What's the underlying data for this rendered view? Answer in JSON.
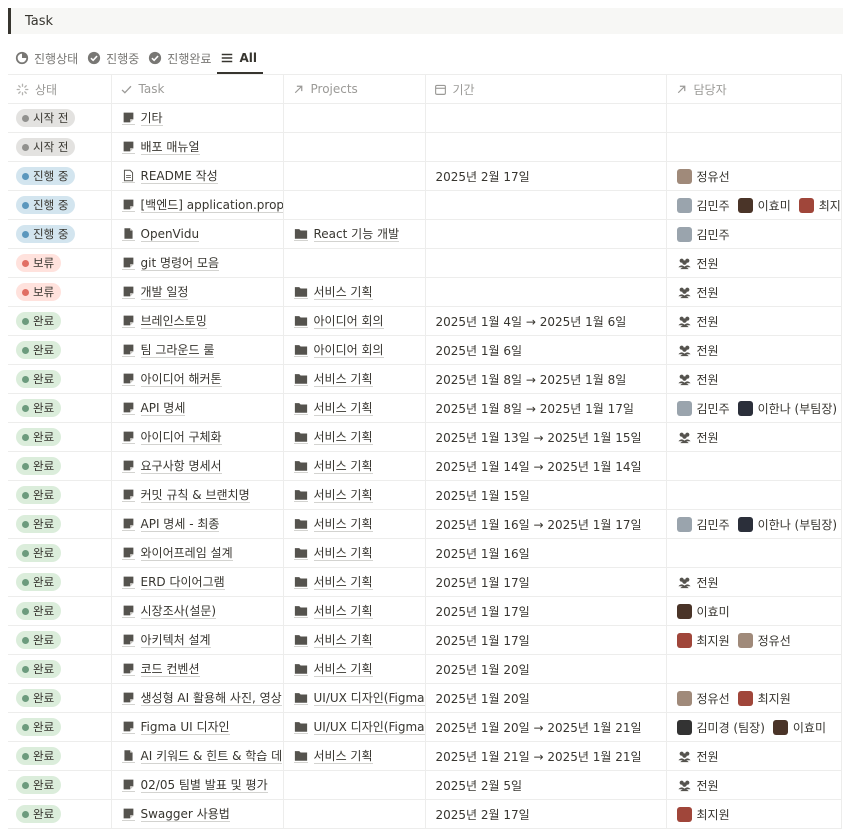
{
  "title": "Task",
  "tabs": [
    {
      "label": "진행상태",
      "icon": "progress-icon",
      "active": false
    },
    {
      "label": "진행중",
      "icon": "check-circle-icon",
      "active": false
    },
    {
      "label": "진행완료",
      "icon": "check-circle-icon",
      "active": false
    },
    {
      "label": "All",
      "icon": "list-icon",
      "active": true
    }
  ],
  "columns": {
    "status": "상태",
    "task": "Task",
    "projects": "Projects",
    "period": "기간",
    "assignee": "담당자"
  },
  "status_colors": {
    "시작 전": {
      "bg": "#e3e2e0",
      "dot": "#91918e"
    },
    "진행 중": {
      "bg": "#d3e5ef",
      "dot": "#5b97bd"
    },
    "보류": {
      "bg": "#ffe2dd",
      "dot": "#e16f64"
    },
    "완료": {
      "bg": "#dbeddb",
      "dot": "#6c9b7d"
    }
  },
  "people": {
    "정유선": {
      "icon": "pencil-avatar-icon",
      "color": "#a08a7a"
    },
    "김민주": {
      "icon": "goat-avatar-icon",
      "color": "#9aa4ad"
    },
    "이효미": {
      "icon": "photo-avatar-icon",
      "color": "#4a3428"
    },
    "최지원": {
      "icon": "monster-avatar-icon",
      "color": "#a0463a"
    },
    "전원": {
      "icon": "group-icon",
      "color": "#555555"
    },
    "이한나 (부팀장)": {
      "icon": "character-avatar-icon",
      "color": "#2b2f3a"
    },
    "김미경 (팀장)": {
      "icon": "illustration-avatar-icon",
      "color": "#333333"
    }
  },
  "rows": [
    {
      "status": "시작 전",
      "task": "기타",
      "task_icon": "page-icon",
      "project": "",
      "period": "",
      "assignees": []
    },
    {
      "status": "시작 전",
      "task": "배포 매뉴얼",
      "task_icon": "page-icon",
      "project": "",
      "period": "",
      "assignees": []
    },
    {
      "status": "진행 중",
      "task": "README 작성",
      "task_icon": "doc-outline-icon",
      "project": "",
      "period": "2025년 2월 17일",
      "assignees": [
        "정유선"
      ]
    },
    {
      "status": "진행 중",
      "task": "[백엔드] application.prope",
      "task_icon": "page-icon",
      "project": "",
      "period": "",
      "assignees": [
        "김민주",
        "이효미",
        "최지"
      ]
    },
    {
      "status": "진행 중",
      "task": "OpenVidu",
      "task_icon": "doc-filled-icon",
      "project": "React 기능 개발",
      "period": "",
      "assignees": [
        "김민주"
      ]
    },
    {
      "status": "보류",
      "task": "git 명령어 모음",
      "task_icon": "page-icon",
      "project": "",
      "period": "",
      "assignees": [
        "전원"
      ]
    },
    {
      "status": "보류",
      "task": "개발 일정",
      "task_icon": "page-icon",
      "project": "서비스 기획",
      "period": "",
      "assignees": [
        "전원"
      ]
    },
    {
      "status": "완료",
      "task": "브레인스토밍",
      "task_icon": "page-icon",
      "project": "아이디어 회의",
      "period": "2025년 1월 4일 → 2025년 1월 6일",
      "assignees": [
        "전원"
      ]
    },
    {
      "status": "완료",
      "task": "팀 그라운드 룰",
      "task_icon": "page-icon",
      "project": "아이디어 회의",
      "period": "2025년 1월 6일",
      "assignees": [
        "전원"
      ]
    },
    {
      "status": "완료",
      "task": "아이디어 해커톤",
      "task_icon": "page-icon",
      "project": "서비스 기획",
      "period": "2025년 1월 8일 → 2025년 1월 8일",
      "assignees": [
        "전원"
      ]
    },
    {
      "status": "완료",
      "task": "API 명세",
      "task_icon": "page-icon",
      "project": "서비스 기획",
      "period": "2025년 1월 8일 → 2025년 1월 17일",
      "assignees": [
        "김민주",
        "이한나 (부팀장)"
      ]
    },
    {
      "status": "완료",
      "task": "아이디어 구체화",
      "task_icon": "page-icon",
      "project": "서비스 기획",
      "period": "2025년 1월 13일 → 2025년 1월 15일",
      "assignees": [
        "전원"
      ]
    },
    {
      "status": "완료",
      "task": "요구사항 명세서",
      "task_icon": "page-icon",
      "project": "서비스 기획",
      "period": "2025년 1월 14일 → 2025년 1월 14일",
      "assignees": []
    },
    {
      "status": "완료",
      "task": "커밋 규칙 & 브랜치명",
      "task_icon": "page-icon",
      "project": "서비스 기획",
      "period": "2025년 1월 15일",
      "assignees": []
    },
    {
      "status": "완료",
      "task": "API 명세 - 최종",
      "task_icon": "page-icon",
      "project": "서비스 기획",
      "period": "2025년 1월 16일 → 2025년 1월 17일",
      "assignees": [
        "김민주",
        "이한나 (부팀장)"
      ]
    },
    {
      "status": "완료",
      "task": "와이어프레임 설계",
      "task_icon": "page-icon",
      "project": "서비스 기획",
      "period": "2025년 1월 16일",
      "assignees": []
    },
    {
      "status": "완료",
      "task": "ERD 다이어그램",
      "task_icon": "page-icon",
      "project": "서비스 기획",
      "period": "2025년 1월 17일",
      "assignees": [
        "전원"
      ]
    },
    {
      "status": "완료",
      "task": "시장조사(설문)",
      "task_icon": "page-icon",
      "project": "서비스 기획",
      "period": "2025년 1월 17일",
      "assignees": [
        "이효미"
      ]
    },
    {
      "status": "완료",
      "task": "아키텍처 설계",
      "task_icon": "page-icon",
      "project": "서비스 기획",
      "period": "2025년 1월 17일",
      "assignees": [
        "최지원",
        "정유선"
      ]
    },
    {
      "status": "완료",
      "task": "코드 컨벤션",
      "task_icon": "page-icon",
      "project": "서비스 기획",
      "period": "2025년 1월 20일",
      "assignees": []
    },
    {
      "status": "완료",
      "task": "생성형 AI 활용해 사진, 영상",
      "task_icon": "page-icon",
      "project": "UI/UX 디자인(Figma)",
      "period": "2025년 1월 20일",
      "assignees": [
        "정유선",
        "최지원"
      ]
    },
    {
      "status": "완료",
      "task": "Figma UI 디자인",
      "task_icon": "page-icon",
      "project": "UI/UX 디자인(Figma)",
      "period": "2025년 1월 20일 → 2025년 1월 21일",
      "assignees": [
        "김미경 (팀장)",
        "이효미"
      ]
    },
    {
      "status": "완료",
      "task": "AI 키워드 & 힌트 & 학습 데",
      "task_icon": "doc-filled-icon",
      "project": "서비스 기획",
      "period": "2025년 1월 21일 → 2025년 1월 21일",
      "assignees": [
        "전원"
      ]
    },
    {
      "status": "완료",
      "task": "02/05 팀별 발표 및 평가",
      "task_icon": "page-icon",
      "project": "",
      "period": "2025년 2월 5일",
      "assignees": [
        "전원"
      ]
    },
    {
      "status": "완료",
      "task": "Swagger 사용법",
      "task_icon": "page-icon",
      "project": "",
      "period": "2025년 2월 17일",
      "assignees": [
        "최지원"
      ]
    }
  ]
}
